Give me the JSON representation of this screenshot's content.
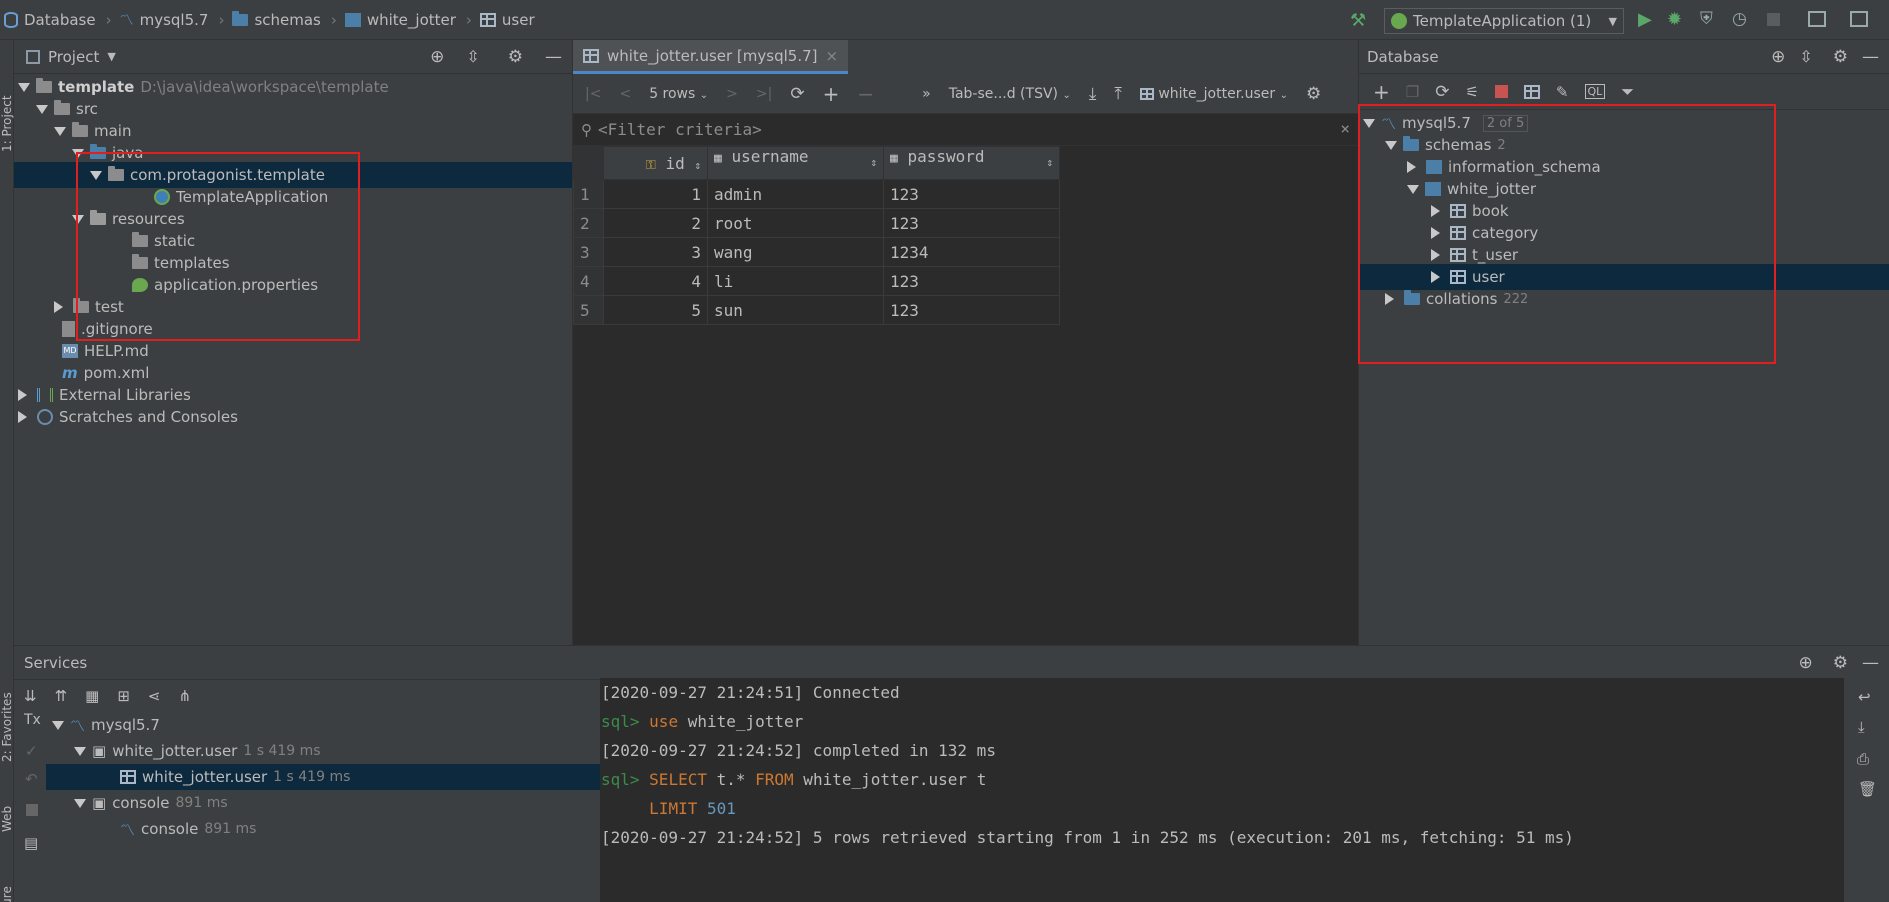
{
  "breadcrumb": [
    "Database",
    "mysql5.7",
    "schemas",
    "white_jotter",
    "user"
  ],
  "run_config": {
    "label": "TemplateApplication (1)"
  },
  "left_strip": {
    "project": "1: Project",
    "favorites": "2: Favorites",
    "web": "Web",
    "structure": "Structure"
  },
  "project_panel": {
    "title": "Project",
    "tree": [
      {
        "label": "template",
        "extra": "D:\\java\\idea\\workspace\\template"
      },
      {
        "label": "src"
      },
      {
        "label": "main"
      },
      {
        "label": "java"
      },
      {
        "label": "com.protagonist.template"
      },
      {
        "label": "TemplateApplication"
      },
      {
        "label": "resources"
      },
      {
        "label": "static"
      },
      {
        "label": "templates"
      },
      {
        "label": "application.properties"
      },
      {
        "label": "test"
      },
      {
        "label": ".gitignore"
      },
      {
        "label": "HELP.md"
      },
      {
        "label": "pom.xml"
      },
      {
        "label": "External Libraries"
      },
      {
        "label": "Scratches and Consoles"
      }
    ]
  },
  "editor": {
    "tab_label": "white_jotter.user [mysql5.7]",
    "rows_label": "5 rows",
    "export_format": "Tab-se...d (TSV)",
    "target": "white_jotter.user",
    "filter_placeholder": "<Filter criteria>",
    "columns": [
      "id",
      "username",
      "password"
    ],
    "rows": [
      {
        "rn": "1",
        "id": "1",
        "username": "admin",
        "password": "123"
      },
      {
        "rn": "2",
        "id": "2",
        "username": "root",
        "password": "123"
      },
      {
        "rn": "3",
        "id": "3",
        "username": "wang",
        "password": "1234"
      },
      {
        "rn": "4",
        "id": "4",
        "username": "li",
        "password": "123"
      },
      {
        "rn": "5",
        "id": "5",
        "username": "sun",
        "password": "123"
      }
    ]
  },
  "database_panel": {
    "title": "Database",
    "tree": [
      {
        "label": "mysql5.7",
        "extra": "2 of 5"
      },
      {
        "label": "schemas",
        "extra": "2"
      },
      {
        "label": "information_schema"
      },
      {
        "label": "white_jotter"
      },
      {
        "label": "book"
      },
      {
        "label": "category"
      },
      {
        "label": "t_user"
      },
      {
        "label": "user"
      },
      {
        "label": "collations",
        "extra": "222"
      }
    ]
  },
  "services": {
    "title": "Services",
    "tx_label": "Tx",
    "tree": [
      {
        "label": "mysql5.7",
        "extra": ""
      },
      {
        "label": "white_jotter.user",
        "extra": "1 s 419 ms"
      },
      {
        "label": "white_jotter.user",
        "extra": "1 s 419 ms"
      },
      {
        "label": "console",
        "extra": "891 ms"
      },
      {
        "label": "console",
        "extra": "891 ms"
      }
    ],
    "console": {
      "line1": "[2020-09-27 21:24:51] Connected",
      "prompt": "sql>",
      "line2_kw": "use",
      "line2_rest": " white_jotter",
      "line3": "[2020-09-27 21:24:52] completed in 132 ms",
      "line4_kw1": "SELECT",
      "line4_mid": " t.* ",
      "line4_kw2": "FROM",
      "line4_rest": " white_jotter.user t",
      "line5_kw": "LIMIT",
      "line5_num": "501",
      "line6": "[2020-09-27 21:24:52] 5 rows retrieved starting from 1 in 252 ms (execution: 201 ms, fetching: 51 ms)"
    }
  },
  "colors": {
    "selection": "#0d293e",
    "highlight": "#e02020",
    "keyword": "#cc7832",
    "prompt": "#3b8c4b",
    "number": "#6897bb"
  }
}
